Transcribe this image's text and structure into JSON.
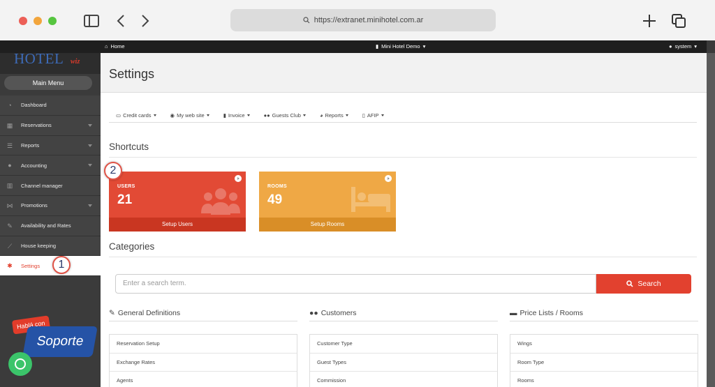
{
  "browser": {
    "url": "https://extranet.minihotel.com.ar"
  },
  "logo": {
    "mini": "mini",
    "hotel": "HOTEL",
    "wiz": "wiz"
  },
  "topnav": {
    "home": "Home",
    "hotel": "Mini Hotel Demo",
    "user": "system"
  },
  "sidebar": {
    "main_menu": "Main Menu",
    "items": [
      {
        "label": "Dashboard",
        "icon": "dashboard-icon"
      },
      {
        "label": "Reservations",
        "icon": "reservations-icon"
      },
      {
        "label": "Reports",
        "icon": "reports-icon"
      },
      {
        "label": "Accounting",
        "icon": "accounting-icon"
      },
      {
        "label": "Channel manager",
        "icon": "channel-icon"
      },
      {
        "label": "Promotions",
        "icon": "promotions-icon"
      },
      {
        "label": "Availability and Rates",
        "icon": "pencil-icon"
      },
      {
        "label": "House keeping",
        "icon": "broom-icon"
      },
      {
        "label": "Settings",
        "icon": "gear-icon"
      }
    ]
  },
  "callouts": {
    "one": "1",
    "two": "2"
  },
  "support": {
    "habla": "Hablá con",
    "soporte": "Soporte"
  },
  "page": {
    "title": "Settings"
  },
  "tabs": [
    {
      "label": "Credit cards"
    },
    {
      "label": "My web site"
    },
    {
      "label": "Invoice"
    },
    {
      "label": "Guests Club"
    },
    {
      "label": "Reports"
    },
    {
      "label": "AFIP"
    }
  ],
  "shortcuts": {
    "title": "Shortcuts",
    "users": {
      "title": "USERS",
      "count": "21",
      "footer": "Setup Users"
    },
    "rooms": {
      "title": "ROOMS",
      "count": "49",
      "footer": "Setup Rooms"
    }
  },
  "categories": {
    "title": "Categories",
    "search_placeholder": "Enter a search term.",
    "search_button": "Search",
    "columns": [
      {
        "title": "General Definitions",
        "items": [
          "Reservation Setup",
          "Exchange Rates",
          "Agents"
        ]
      },
      {
        "title": "Customers",
        "items": [
          "Customer Type",
          "Guest Types",
          "Commission"
        ]
      },
      {
        "title": "Price Lists / Rooms",
        "items": [
          "Wings",
          "Room Type",
          "Rooms"
        ]
      }
    ]
  },
  "colors": {
    "accent": "#e2412f",
    "users_card": "#e24a35",
    "rooms_card": "#efa845"
  }
}
